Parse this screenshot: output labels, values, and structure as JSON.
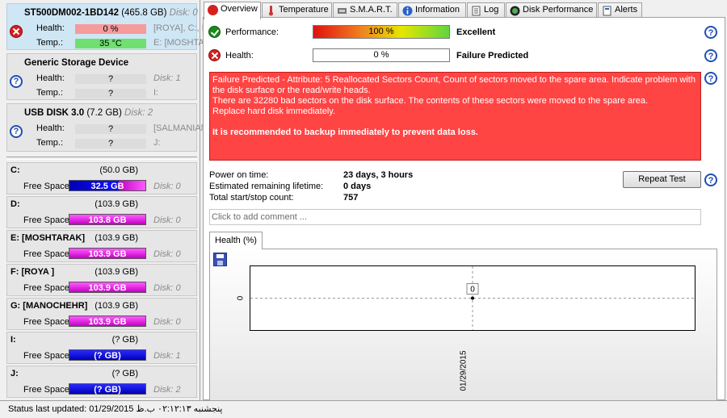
{
  "disks": [
    {
      "title": "ST500DM002-1BD142",
      "size": "(465.8 GB)",
      "disk_label": "Disk: 0",
      "health_label": "Health:",
      "health_value": "0 %",
      "temp_label": "Temp.:",
      "temp_value": "35 °C",
      "health_extra": "[ROYA], C:, D:",
      "temp_extra": "E: [MOSHTARAK]",
      "status_icon": "error-icon"
    },
    {
      "title": "Generic Storage Device",
      "size": "",
      "disk_label": "",
      "health_label": "Health:",
      "health_value": "?",
      "temp_label": "Temp.:",
      "temp_value": "?",
      "health_extra": "Disk: 1",
      "temp_extra": "I:",
      "status_icon": "help-icon"
    },
    {
      "title": "USB DISK 3.0",
      "size": "(7.2 GB)",
      "disk_label": "Disk: 2",
      "health_label": "Health:",
      "health_value": "?",
      "temp_label": "Temp.:",
      "temp_value": "?",
      "health_extra": "[SALMANIAN]",
      "temp_extra": "J:",
      "status_icon": "help-icon"
    }
  ],
  "partitions": [
    {
      "name": "C:",
      "size": "(50.0 GB)",
      "free_label": "Free Space",
      "free": "32.5 GB",
      "disk": "Disk: 0",
      "color": "#c400c4"
    },
    {
      "name": "D:",
      "size": "(103.9 GB)",
      "free_label": "Free Space",
      "free": "103.8 GB",
      "disk": "Disk: 0",
      "color": "#c400c4"
    },
    {
      "name": "E: [MOSHTARAK]",
      "size": "(103.9 GB)",
      "free_label": "Free Space",
      "free": "103.9 GB",
      "disk": "Disk: 0",
      "color": "#c400c4"
    },
    {
      "name": "F: [ROYA ]",
      "size": "(103.9 GB)",
      "free_label": "Free Space",
      "free": "103.9 GB",
      "disk": "Disk: 0",
      "color": "#c400c4"
    },
    {
      "name": "G: [MANOCHEHR]",
      "size": "(103.9 GB)",
      "free_label": "Free Space",
      "free": "103.9 GB",
      "disk": "Disk: 0",
      "color": "#c400c4"
    },
    {
      "name": "I:",
      "size": "(? GB)",
      "free_label": "Free Space",
      "free": "(? GB)",
      "disk": "Disk: 1",
      "color": "#0000d0"
    },
    {
      "name": "J:",
      "size": "(? GB)",
      "free_label": "Free Space",
      "free": "(? GB)",
      "disk": "Disk: 2",
      "color": "#0000d0"
    }
  ],
  "tabs": [
    "Overview",
    "Temperature",
    "S.M.A.R.T.",
    "Information",
    "Log",
    "Disk Performance",
    "Alerts"
  ],
  "overview": {
    "performance_label": "Performance:",
    "performance_value": "100 %",
    "performance_pct": 100,
    "performance_rating": "Excellent",
    "health_label": "Health:",
    "health_value": "0 %",
    "health_pct": 0,
    "health_rating": "Failure Predicted",
    "alert_lines": [
      "Failure Predicted - Attribute: 5 Reallocated Sectors Count, Count of sectors moved to the spare area. Indicate problem with the disk surface or the read/write heads.",
      "There are 32280 bad sectors on the disk surface. The contents of these sectors were moved to the spare area.",
      "Replace hard disk immediately."
    ],
    "alert_strong": "It is recommended to backup immediately to prevent data loss.",
    "power_on_label": "Power on time:",
    "power_on_value": "23 days, 3 hours",
    "lifetime_label": "Estimated remaining lifetime:",
    "lifetime_value": "0 days",
    "startstop_label": "Total start/stop count:",
    "startstop_value": "757",
    "repeat_test_label": "Repeat Test",
    "comment_placeholder": "Click to add comment ...",
    "chart_tab_label": "Health (%)"
  },
  "chart_data": {
    "type": "line",
    "title": "Health (%)",
    "x": [
      "01/29/2015"
    ],
    "series": [
      {
        "values": [
          0
        ]
      }
    ],
    "yticks": [
      "0"
    ],
    "data_labels": [
      "0"
    ],
    "grid": true
  },
  "status_bar": {
    "text": "Status last updated: 01/29/2015 پنجشنبه ۰۲:۱۲:۱۳ ب.ظ"
  },
  "colors": {
    "accent_selected": "#cfe6f5",
    "alert_bg": "#ff4444",
    "error": "#d61f1f",
    "ok": "#1c8a1c",
    "partition_magenta": "#c400c4",
    "partition_blue": "#0000d0"
  }
}
